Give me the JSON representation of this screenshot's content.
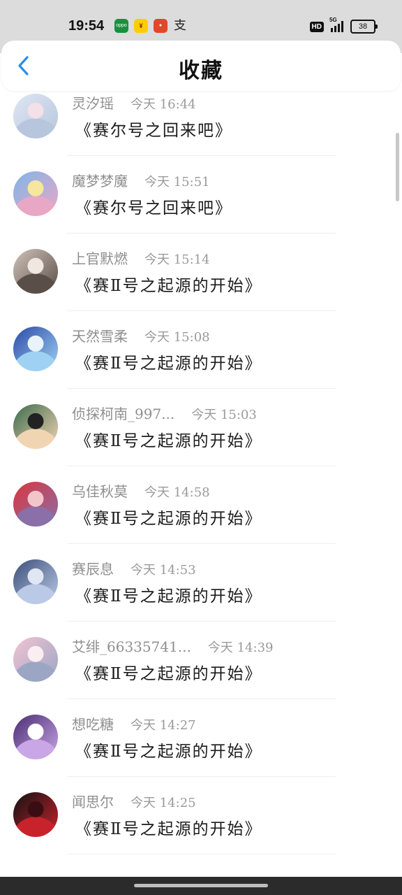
{
  "status_bar": {
    "time": "19:54",
    "apps": [
      "oppo",
      "pay",
      "red-app",
      "支"
    ],
    "hd": "HD",
    "network": "5G",
    "battery": "38"
  },
  "header": {
    "title": "收藏",
    "back_icon": "chevron-left-icon"
  },
  "favorites": [
    {
      "name": "灵汐瑶",
      "time": "今天 16:44",
      "title": "《赛尔号之回来吧》",
      "avatar_colors": [
        "#dfe6f3",
        "#b7c6dd",
        "#f3e1e7"
      ]
    },
    {
      "name": "魔梦梦魔",
      "time": "今天 15:51",
      "title": "《赛尔号之回来吧》",
      "avatar_colors": [
        "#7fb6e8",
        "#e9a7c6",
        "#f5e6a0"
      ]
    },
    {
      "name": "上官默燃",
      "time": "今天 15:14",
      "title": "《赛Ⅱ号之起源的开始》",
      "avatar_colors": [
        "#cfc2b8",
        "#5a4e48",
        "#efe7e0"
      ]
    },
    {
      "name": "天然雪柔",
      "time": "今天 15:08",
      "title": "《赛Ⅱ号之起源的开始》",
      "avatar_colors": [
        "#2b4aa8",
        "#9fd1f2",
        "#e8f3fb"
      ]
    },
    {
      "name": "侦探柯南_997...",
      "time": "今天 15:03",
      "title": "《赛Ⅱ号之起源的开始》",
      "avatar_colors": [
        "#3e6b4e",
        "#f1d5b3",
        "#222222"
      ]
    },
    {
      "name": "乌佳秋莫",
      "time": "今天 14:58",
      "title": "《赛Ⅱ号之起源的开始》",
      "avatar_colors": [
        "#d9363e",
        "#8a6fa8",
        "#f2c6c9"
      ]
    },
    {
      "name": "赛辰息",
      "time": "今天 14:53",
      "title": "《赛Ⅱ号之起源的开始》",
      "avatar_colors": [
        "#3c4f7a",
        "#b9c9e6",
        "#e0e7f3"
      ]
    },
    {
      "name": "艾绯_66335741...",
      "time": "今天 14:39",
      "title": "《赛Ⅱ号之起源的开始》",
      "avatar_colors": [
        "#f3c3d3",
        "#9aa6c4",
        "#fbeef3"
      ]
    },
    {
      "name": "想吃糖",
      "time": "今天 14:27",
      "title": "《赛Ⅱ号之起源的开始》",
      "avatar_colors": [
        "#4a2c73",
        "#c9a6e6",
        "#ffffff"
      ]
    },
    {
      "name": "闻思尔",
      "time": "今天 14:25",
      "title": "《赛Ⅱ号之起源的开始》",
      "avatar_colors": [
        "#121212",
        "#c8232c",
        "#3a0d12"
      ]
    }
  ]
}
